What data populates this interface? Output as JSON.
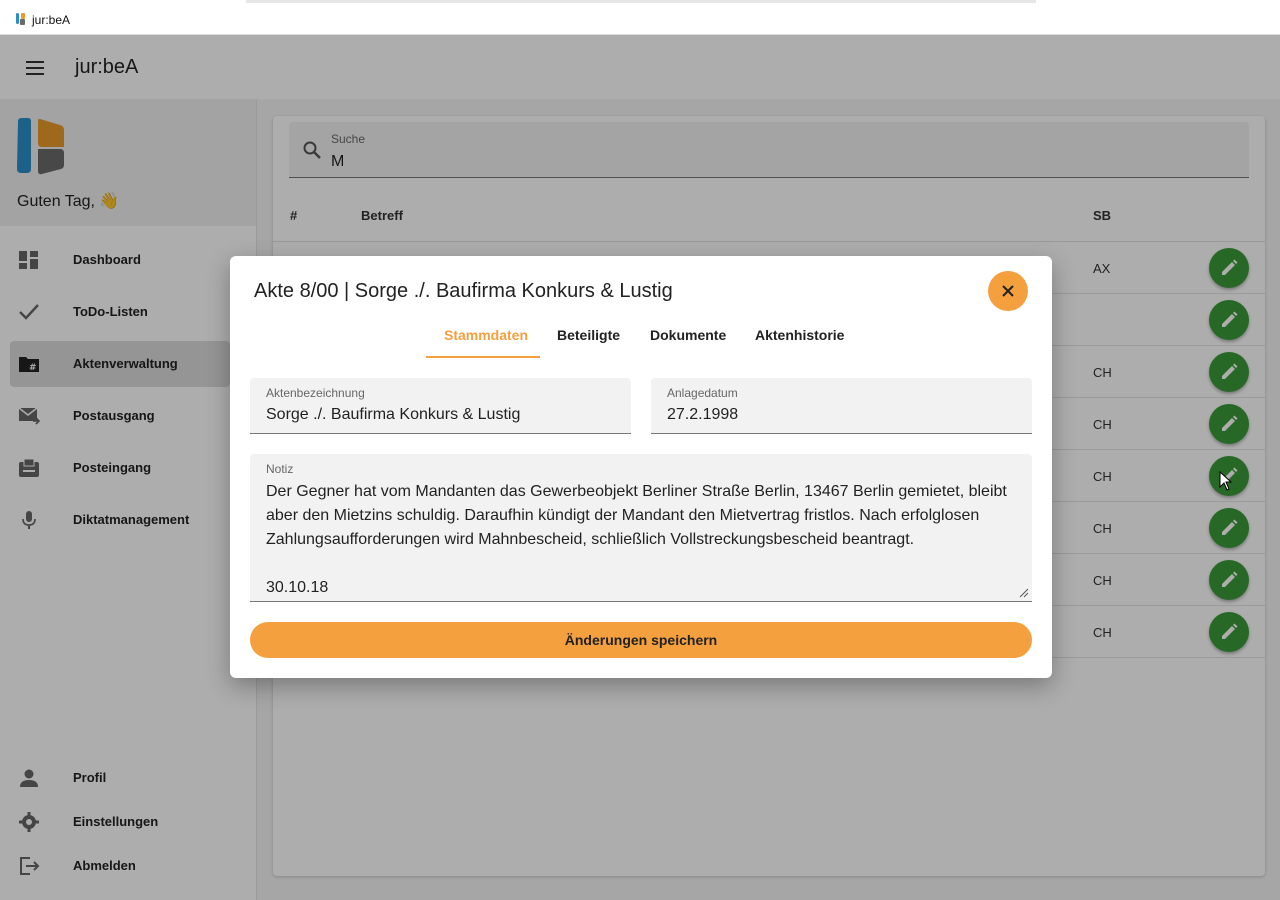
{
  "window": {
    "title": "jur:beA"
  },
  "header": {
    "app_name": "jur:beA"
  },
  "sidebar": {
    "greeting": "Guten Tag, 👋",
    "items": [
      {
        "label": "Dashboard",
        "icon": "dashboard-icon"
      },
      {
        "label": "ToDo-Listen",
        "icon": "check-icon"
      },
      {
        "label": "Aktenverwaltung",
        "icon": "folder-hash-icon",
        "active": true
      },
      {
        "label": "Postausgang",
        "icon": "mail-send-icon"
      },
      {
        "label": "Posteingang",
        "icon": "inbox-icon"
      },
      {
        "label": "Diktatmanagement",
        "icon": "microphone-icon"
      }
    ],
    "bottom_items": [
      {
        "label": "Profil",
        "icon": "person-icon"
      },
      {
        "label": "Einstellungen",
        "icon": "gear-icon"
      },
      {
        "label": "Abmelden",
        "icon": "logout-icon"
      }
    ]
  },
  "content": {
    "search": {
      "label": "Suche",
      "value": "M"
    },
    "table": {
      "columns": [
        "#",
        "Betreff",
        "SB"
      ],
      "rows": [
        {
          "sb": "AX"
        },
        {
          "sb": ""
        },
        {
          "sb": "CH"
        },
        {
          "sb": "CH"
        },
        {
          "sb": "CH"
        },
        {
          "sb": "CH"
        },
        {
          "sb": "CH"
        },
        {
          "sb": "CH"
        }
      ]
    }
  },
  "dialog": {
    "title": "Akte 8/00 | Sorge ./. Baufirma Konkurs & Lustig",
    "tabs": [
      "Stammdaten",
      "Beteiligte",
      "Dokumente",
      "Aktenhistorie"
    ],
    "active_tab": "Stammdaten",
    "fields": {
      "aktenbezeichnung": {
        "label": "Aktenbezeichnung",
        "value": "Sorge ./. Baufirma Konkurs & Lustig"
      },
      "anlagedatum": {
        "label": "Anlagedatum",
        "value": "27.2.1998"
      },
      "notiz": {
        "label": "Notiz",
        "value": "Der Gegner hat vom Mandanten das Gewerbeobjekt Berliner Straße Berlin, 13467 Berlin gemietet, bleibt aber den Mietzins schuldig. Daraufhin kündigt der Mandant den Mietvertrag fristlos. Nach erfolglosen Zahlungsaufforderungen wird Mahnbescheid, schließlich Vollstreckungsbescheid beantragt.\n\n30.10.18"
      }
    },
    "save_label": "Änderungen speichern"
  },
  "colors": {
    "accent": "#f5a03f",
    "edit_button": "#3a9a3a",
    "logo_blue": "#2a8fc8",
    "logo_orange": "#e99b2a",
    "logo_gray": "#6b6b6b"
  }
}
